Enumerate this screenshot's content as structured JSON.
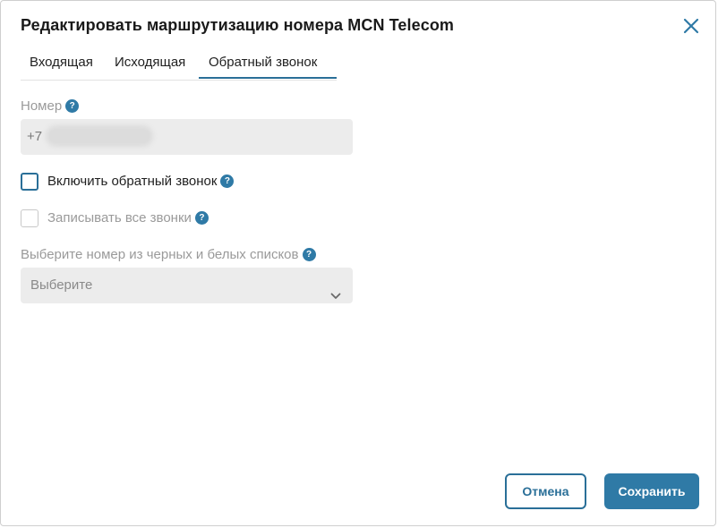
{
  "dialog": {
    "title": "Редактировать маршрутизацию номера MCN Telecom"
  },
  "tabs": [
    {
      "label": "Входящая",
      "active": false
    },
    {
      "label": "Исходящая",
      "active": false
    },
    {
      "label": "Обратный звонок",
      "active": true
    }
  ],
  "form": {
    "number_label": "Номер",
    "number_prefix": "+7",
    "callback_checkbox": {
      "label": "Включить обратный звонок",
      "checked": false,
      "enabled": true
    },
    "record_checkbox": {
      "label": "Записывать все звонки",
      "checked": false,
      "enabled": false
    },
    "list_label": "Выберите номер из черных и белых списков",
    "list_select_value": "Выберите",
    "help_glyph": "?"
  },
  "footer": {
    "cancel_label": "Отмена",
    "save_label": "Сохранить"
  },
  "colors": {
    "accent": "#2f7aa6",
    "field_bg": "#ececec"
  },
  "icons": [
    "close-icon",
    "help-icon",
    "chevron-down-icon"
  ]
}
